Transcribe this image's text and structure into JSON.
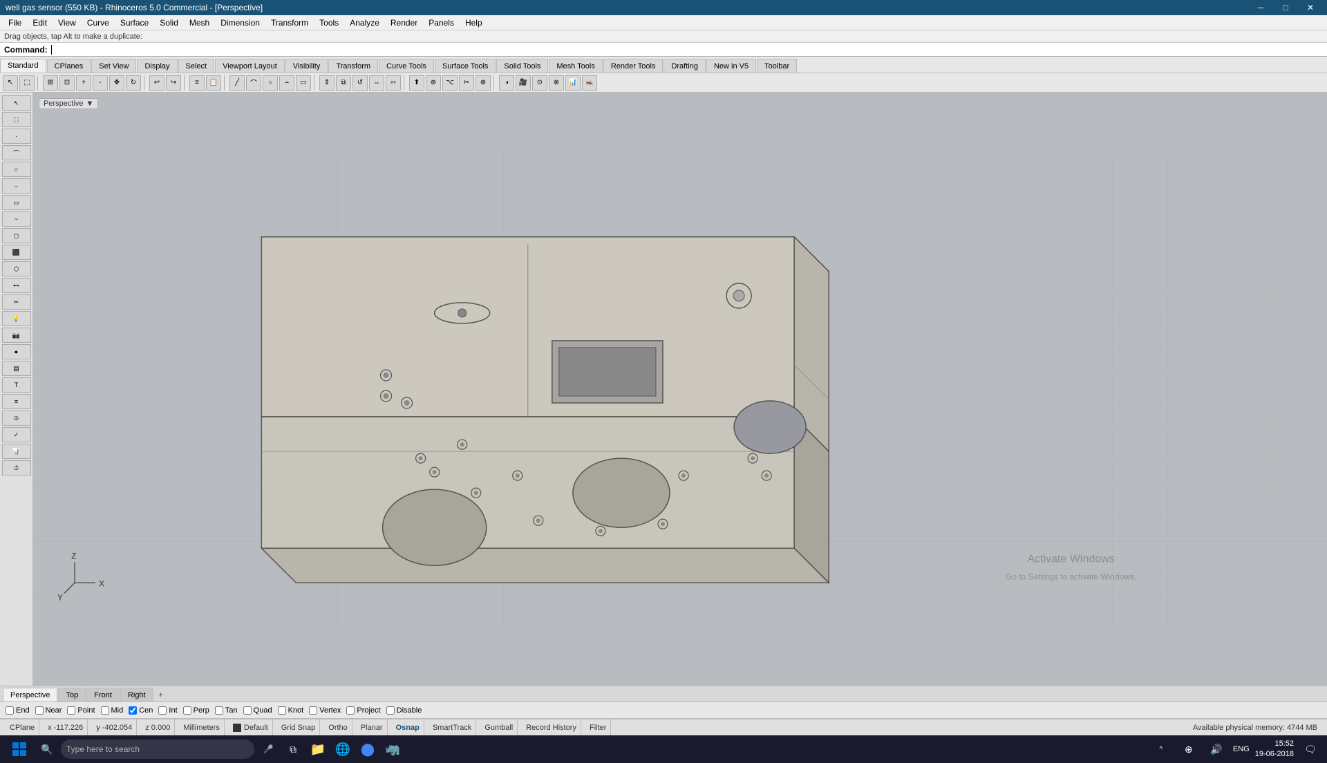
{
  "window": {
    "title": "well gas sensor (550 KB) - Rhinoceros 5.0 Commercial - [Perspective]"
  },
  "titlebar": {
    "title": "well gas sensor (550 KB) - Rhinoceros 5.0 Commercial - [Perspective]",
    "min_label": "─",
    "max_label": "□",
    "close_label": "✕"
  },
  "menubar": {
    "items": [
      "File",
      "Edit",
      "View",
      "Curve",
      "Surface",
      "Solid",
      "Mesh",
      "Dimension",
      "Transform",
      "Tools",
      "Analyze",
      "Render",
      "Panels",
      "Help"
    ]
  },
  "statusbar1": {
    "text": "Drag objects, tap Alt to make a duplicate:"
  },
  "commandbar": {
    "label": "Command:",
    "value": ""
  },
  "tabs": {
    "items": [
      "Standard",
      "CPlanes",
      "Set View",
      "Display",
      "Select",
      "Viewport Layout",
      "Visibility",
      "Transform",
      "Curve Tools",
      "Surface Tools",
      "Solid Tools",
      "Mesh Tools",
      "Render Tools",
      "Drafting",
      "New in V5",
      "Toolbar"
    ]
  },
  "viewport": {
    "label": "Perspective",
    "dropdown_arrow": "▼"
  },
  "vp_tabs": {
    "items": [
      "Perspective",
      "Top",
      "Front",
      "Right"
    ],
    "active": "Perspective",
    "add_label": "+"
  },
  "osnap": {
    "items": [
      {
        "label": "End",
        "checked": false
      },
      {
        "label": "Near",
        "checked": false
      },
      {
        "label": "Point",
        "checked": false
      },
      {
        "label": "Mid",
        "checked": false
      },
      {
        "label": "Cen",
        "checked": true
      },
      {
        "label": "Int",
        "checked": false
      },
      {
        "label": "Perp",
        "checked": false
      },
      {
        "label": "Tan",
        "checked": false
      },
      {
        "label": "Quad",
        "checked": false
      },
      {
        "label": "Knot",
        "checked": false
      },
      {
        "label": "Vertex",
        "checked": false
      },
      {
        "label": "Project",
        "checked": false
      },
      {
        "label": "Disable",
        "checked": false
      }
    ]
  },
  "bottombar": {
    "cplane": "CPlane",
    "x": "x -117.226",
    "y": "y -402.054",
    "z": "z 0.000",
    "units": "Millimeters",
    "layer": "Default",
    "grid_snap": "Grid Snap",
    "ortho": "Ortho",
    "planar": "Planar",
    "osnap": "Osnap",
    "smarttrack": "SmartTrack",
    "gumball": "Gumball",
    "record_history": "Record History",
    "filter": "Filter",
    "memory": "Available physical memory: 4744 MB"
  },
  "taskbar": {
    "search_placeholder": "Type here to search",
    "time": "15:52",
    "date": "19-06-2018",
    "language": "ENG"
  },
  "watermark": {
    "line1": "Activate Windows",
    "line2": "Go to Settings to activate Windows."
  },
  "axes": {
    "label": "Y  Z\n  X"
  },
  "icons": {
    "search": "🔍",
    "mic": "🎤",
    "taskview": "⧉",
    "explorer": "📁",
    "edge": "🌐",
    "rhino": "🦏",
    "network": "⊕",
    "speaker": "🔊",
    "chevron": "^"
  }
}
